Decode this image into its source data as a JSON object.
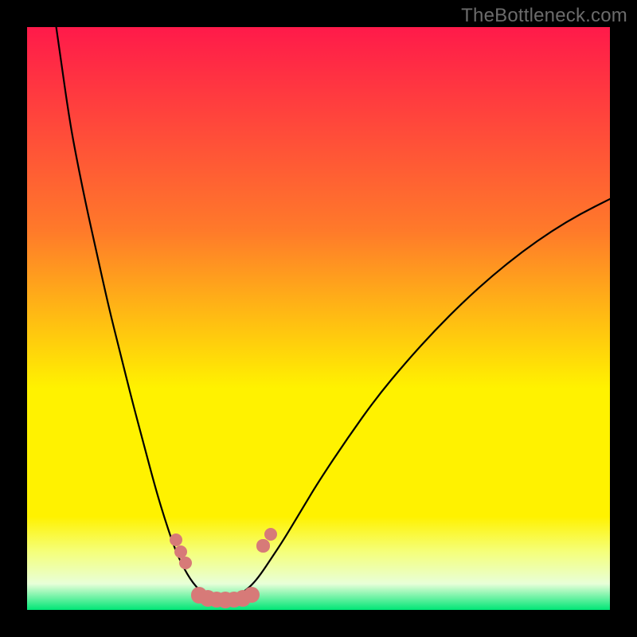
{
  "watermark": "TheBottleneck.com",
  "colors": {
    "gradient_top": "#ff1a4a",
    "gradient_mid_upper": "#ff7a2a",
    "gradient_mid": "#fff200",
    "gradient_lower": "#f5ff7a",
    "gradient_pale": "#e8ffd8",
    "gradient_bottom": "#00e676",
    "bg": "#000000",
    "curve": "#000000",
    "dot": "#d77a78"
  },
  "chart_data": {
    "type": "line",
    "title": "",
    "xlabel": "",
    "ylabel": "",
    "xlim": [
      0,
      100
    ],
    "ylim": [
      0,
      100
    ],
    "grid": false,
    "legend_position": "none",
    "series": [
      {
        "name": "left-curve",
        "x": [
          5,
          6,
          7,
          8,
          10,
          12,
          14,
          16,
          18,
          20,
          22,
          23.5,
          25,
          26,
          27,
          28,
          29,
          30,
          31.5,
          33
        ],
        "y": [
          100,
          93,
          86,
          80,
          70,
          61,
          52,
          44,
          36,
          28.5,
          21,
          16,
          11.5,
          9,
          7,
          5.3,
          4,
          3,
          2,
          1.5
        ]
      },
      {
        "name": "valley-floor",
        "x": [
          29.5,
          31,
          32.5,
          34,
          35.5,
          37,
          38.5
        ],
        "y": [
          2.0,
          1.5,
          1.3,
          1.2,
          1.3,
          1.5,
          2.0
        ]
      },
      {
        "name": "right-curve",
        "x": [
          35,
          36,
          37,
          38.5,
          40,
          42,
          44,
          47,
          50,
          55,
          60,
          65,
          70,
          75,
          80,
          85,
          90,
          95,
          100
        ],
        "y": [
          1.5,
          2.0,
          3.0,
          4.2,
          6.0,
          9.0,
          12.0,
          17.0,
          22.0,
          29.5,
          36.5,
          42.5,
          48.0,
          53.0,
          57.5,
          61.5,
          65.0,
          68.0,
          70.5
        ]
      }
    ],
    "markers": [
      {
        "name": "left-upper-1",
        "x": 25.6,
        "y": 12.0,
        "r": 1.1
      },
      {
        "name": "left-upper-2",
        "x": 26.4,
        "y": 10.0,
        "r": 1.1
      },
      {
        "name": "left-upper-3",
        "x": 27.2,
        "y": 8.0,
        "r": 1.1
      },
      {
        "name": "right-upper-1",
        "x": 40.5,
        "y": 11.0,
        "r": 1.1
      },
      {
        "name": "right-upper-2",
        "x": 41.8,
        "y": 13.0,
        "r": 1.1
      },
      {
        "name": "floor-1",
        "x": 29.5,
        "y": 2.5,
        "r": 1.4
      },
      {
        "name": "floor-2",
        "x": 31.0,
        "y": 2.0,
        "r": 1.4
      },
      {
        "name": "floor-3",
        "x": 32.5,
        "y": 1.8,
        "r": 1.4
      },
      {
        "name": "floor-4",
        "x": 34.0,
        "y": 1.7,
        "r": 1.4
      },
      {
        "name": "floor-5",
        "x": 35.5,
        "y": 1.8,
        "r": 1.4
      },
      {
        "name": "floor-6",
        "x": 37.0,
        "y": 2.0,
        "r": 1.4
      },
      {
        "name": "floor-7",
        "x": 38.5,
        "y": 2.6,
        "r": 1.4
      }
    ],
    "gradient_bands": [
      {
        "pos": 0.0,
        "color": "#ff1a4a"
      },
      {
        "pos": 0.35,
        "color": "#ff7a2a"
      },
      {
        "pos": 0.62,
        "color": "#fff200"
      },
      {
        "pos": 0.84,
        "color": "#fff200"
      },
      {
        "pos": 0.9,
        "color": "#f5ff7a"
      },
      {
        "pos": 0.955,
        "color": "#e8ffd8"
      },
      {
        "pos": 1.0,
        "color": "#00e676"
      }
    ]
  }
}
